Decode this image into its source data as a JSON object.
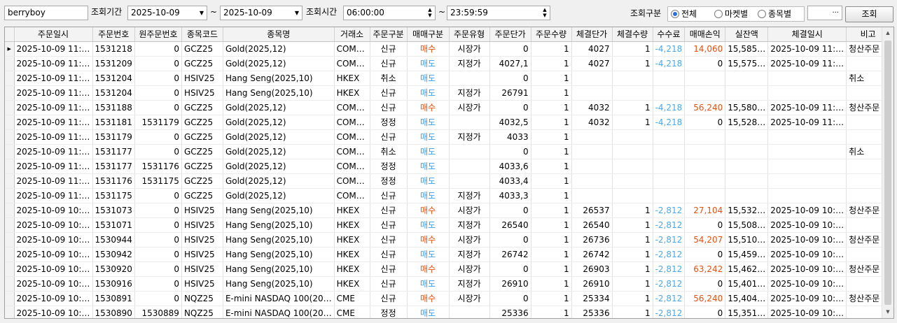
{
  "toolbar": {
    "account": "berryboy",
    "period_label": "조회기간",
    "date_from": "2025-10-09",
    "tilde": "~",
    "date_to": "2025-10-09",
    "time_label": "조회시간",
    "time_from": "06:00:00",
    "time_to": "23:59:59",
    "category_label": "조회구분",
    "radio_all": "전체",
    "radio_market": "마켓별",
    "radio_item": "종목별",
    "selected_radio": "전체",
    "extra_value": "···",
    "search_button": "조회"
  },
  "table": {
    "columns": [
      "주문일시",
      "주문번호",
      "원주문번호",
      "종목코드",
      "종목명",
      "거래소",
      "주문구분",
      "매매구분",
      "주문유형",
      "주문단가",
      "주문수량",
      "체결단가",
      "체결수량",
      "수수료",
      "매매손익",
      "실잔액",
      "체결일시",
      "비고"
    ],
    "rows": [
      [
        "2025-10-09 11:…",
        "1531218",
        "0",
        "GCZ25",
        "Gold(2025,12)",
        "COM…",
        "신규",
        "매수",
        "시장가",
        "0",
        "1",
        "4027",
        "1",
        "-4,218",
        "14,060",
        "15,585…",
        "2025-10-09 11:…",
        "청산주문"
      ],
      [
        "2025-10-09 11:…",
        "1531209",
        "0",
        "GCZ25",
        "Gold(2025,12)",
        "COM…",
        "신규",
        "매도",
        "지정가",
        "4027,1",
        "1",
        "4027",
        "1",
        "-4,218",
        "0",
        "15,575…",
        "2025-10-09 11:…",
        ""
      ],
      [
        "2025-10-09 11:…",
        "1531204",
        "0",
        "HSIV25",
        "Hang Seng(2025,10)",
        "HKEX",
        "취소",
        "매도",
        "",
        "0",
        "1",
        "",
        "",
        "",
        "",
        "",
        "",
        "취소"
      ],
      [
        "2025-10-09 11:…",
        "1531204",
        "0",
        "HSIV25",
        "Hang Seng(2025,10)",
        "HKEX",
        "신규",
        "매도",
        "지정가",
        "26791",
        "1",
        "",
        "",
        "",
        "",
        "",
        "",
        ""
      ],
      [
        "2025-10-09 11:…",
        "1531188",
        "0",
        "GCZ25",
        "Gold(2025,12)",
        "COM…",
        "신규",
        "매수",
        "시장가",
        "0",
        "1",
        "4032",
        "1",
        "-4,218",
        "56,240",
        "15,580…",
        "2025-10-09 11:…",
        "청산주문"
      ],
      [
        "2025-10-09 11:…",
        "1531181",
        "1531179",
        "GCZ25",
        "Gold(2025,12)",
        "COM…",
        "정정",
        "매도",
        "",
        "4032,5",
        "1",
        "4032",
        "1",
        "-4,218",
        "0",
        "15,528…",
        "2025-10-09 11:…",
        ""
      ],
      [
        "2025-10-09 11:…",
        "1531179",
        "0",
        "GCZ25",
        "Gold(2025,12)",
        "COM…",
        "신규",
        "매도",
        "지정가",
        "4033",
        "1",
        "",
        "",
        "",
        "",
        "",
        "",
        ""
      ],
      [
        "2025-10-09 11:…",
        "1531177",
        "0",
        "GCZ25",
        "Gold(2025,12)",
        "COM…",
        "취소",
        "매도",
        "",
        "0",
        "1",
        "",
        "",
        "",
        "",
        "",
        "",
        "취소"
      ],
      [
        "2025-10-09 11:…",
        "1531177",
        "1531176",
        "GCZ25",
        "Gold(2025,12)",
        "COM…",
        "정정",
        "매도",
        "",
        "4033,6",
        "1",
        "",
        "",
        "",
        "",
        "",
        "",
        ""
      ],
      [
        "2025-10-09 11:…",
        "1531176",
        "1531175",
        "GCZ25",
        "Gold(2025,12)",
        "COM…",
        "정정",
        "매도",
        "",
        "4033,4",
        "1",
        "",
        "",
        "",
        "",
        "",
        "",
        ""
      ],
      [
        "2025-10-09 11:…",
        "1531175",
        "0",
        "GCZ25",
        "Gold(2025,12)",
        "COM…",
        "신규",
        "매도",
        "지정가",
        "4033,3",
        "1",
        "",
        "",
        "",
        "",
        "",
        "",
        ""
      ],
      [
        "2025-10-09 10:…",
        "1531073",
        "0",
        "HSIV25",
        "Hang Seng(2025,10)",
        "HKEX",
        "신규",
        "매수",
        "시장가",
        "0",
        "1",
        "26537",
        "1",
        "-2,812",
        "27,104",
        "15,532…",
        "2025-10-09 10:…",
        "청산주문"
      ],
      [
        "2025-10-09 10:…",
        "1531071",
        "0",
        "HSIV25",
        "Hang Seng(2025,10)",
        "HKEX",
        "신규",
        "매도",
        "지정가",
        "26540",
        "1",
        "26540",
        "1",
        "-2,812",
        "0",
        "15,508…",
        "2025-10-09 10:…",
        ""
      ],
      [
        "2025-10-09 10:…",
        "1530944",
        "0",
        "HSIV25",
        "Hang Seng(2025,10)",
        "HKEX",
        "신규",
        "매수",
        "시장가",
        "0",
        "1",
        "26736",
        "1",
        "-2,812",
        "54,207",
        "15,510…",
        "2025-10-09 10:…",
        "청산주문"
      ],
      [
        "2025-10-09 10:…",
        "1530942",
        "0",
        "HSIV25",
        "Hang Seng(2025,10)",
        "HKEX",
        "신규",
        "매도",
        "지정가",
        "26742",
        "1",
        "26742",
        "1",
        "-2,812",
        "0",
        "15,459…",
        "2025-10-09 10:…",
        ""
      ],
      [
        "2025-10-09 10:…",
        "1530920",
        "0",
        "HSIV25",
        "Hang Seng(2025,10)",
        "HKEX",
        "신규",
        "매수",
        "시장가",
        "0",
        "1",
        "26903",
        "1",
        "-2,812",
        "63,242",
        "15,462…",
        "2025-10-09 10:…",
        "청산주문"
      ],
      [
        "2025-10-09 10:…",
        "1530916",
        "0",
        "HSIV25",
        "Hang Seng(2025,10)",
        "HKEX",
        "신규",
        "매도",
        "지정가",
        "26910",
        "1",
        "26910",
        "1",
        "-2,812",
        "0",
        "15,401…",
        "2025-10-09 10:…",
        ""
      ],
      [
        "2025-10-09 10:…",
        "1530891",
        "0",
        "NQZ25",
        "E-mini NASDAQ 100(20…",
        "CME",
        "신규",
        "매수",
        "시장가",
        "0",
        "1",
        "25334",
        "1",
        "-2,812",
        "56,240",
        "15,404…",
        "2025-10-09 10:…",
        "청산주문"
      ],
      [
        "2025-10-09 10:…",
        "1530890",
        "1530889",
        "NQZ25",
        "E-mini NASDAQ 100(20…",
        "CME",
        "정정",
        "매도",
        "",
        "25336",
        "1",
        "25336",
        "1",
        "-2,812",
        "0",
        "15,351…",
        "2025-10-09 10:…",
        ""
      ]
    ]
  },
  "colors": {
    "buy": "#e8500e",
    "sell": "#3c9be8",
    "fee": "#4aa8e8",
    "profit": "#e8500e"
  }
}
